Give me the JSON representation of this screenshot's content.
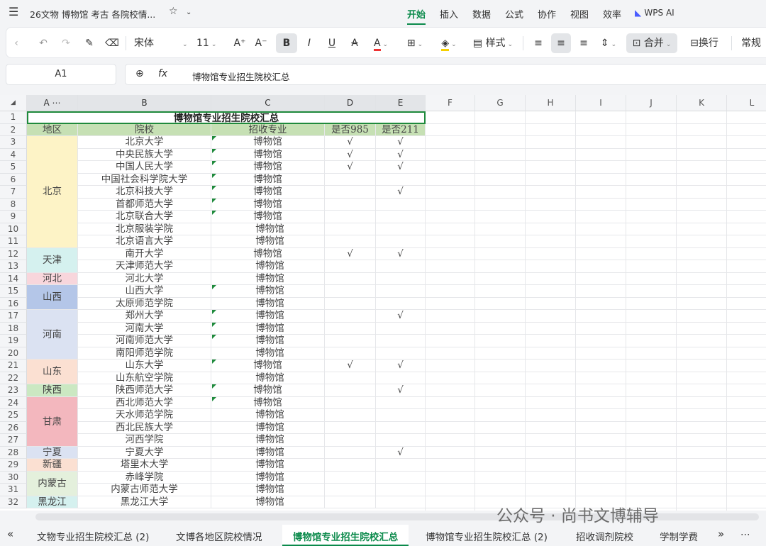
{
  "titlebar": {
    "menu_icon": "hamburger-icon",
    "doc_title": "26文物 博物馆 考古 各院校情...",
    "star_icon": "star-icon",
    "chevron_icon": "chevron-down-icon",
    "menus": [
      "开始",
      "插入",
      "数据",
      "公式",
      "协作",
      "视图",
      "效率"
    ],
    "active_menu": "开始",
    "ai_label": "WPS AI"
  },
  "toolbar": {
    "font_name": "宋体",
    "font_size": "11",
    "style_label": "样式",
    "merge_label": "合并",
    "wrap_label": "换行",
    "format_label": "常规"
  },
  "formula_bar": {
    "cell_ref": "A1",
    "fx": "fx",
    "content": "博物馆专业招生院校汇总"
  },
  "columns": [
    "A",
    "B",
    "C",
    "D",
    "E",
    "F",
    "G",
    "H",
    "I",
    "J",
    "K",
    "L"
  ],
  "rows": [
    "1",
    "2",
    "3",
    "4",
    "5",
    "6",
    "7",
    "8",
    "9",
    "10",
    "11",
    "12",
    "13",
    "14",
    "15",
    "16",
    "17",
    "18",
    "19",
    "20",
    "21",
    "22",
    "23",
    "24",
    "25",
    "26",
    "27",
    "28",
    "29",
    "30",
    "31",
    "32"
  ],
  "sheet": {
    "title": "博物馆专业招生院校汇总",
    "headers": [
      "地区",
      "院校",
      "招收专业",
      "是否985",
      "是否211"
    ],
    "regions": [
      {
        "name": "北京",
        "color": "#fdf3c6"
      },
      {
        "name": "天津",
        "color": "#d5f1ef"
      },
      {
        "name": "河北",
        "color": "#f8d6dc"
      },
      {
        "name": "山西",
        "color": "#b4c6e8"
      },
      {
        "name": "河南",
        "color": "#dbe2f2"
      },
      {
        "name": "山东",
        "color": "#fbe0d2"
      },
      {
        "name": "陕西",
        "color": "#cbe8c2"
      },
      {
        "name": "甘肃",
        "color": "#f3b7be"
      },
      {
        "name": "宁夏",
        "color": "#dbe2f2"
      },
      {
        "name": "新疆",
        "color": "#fbe0d2"
      },
      {
        "name": "内蒙古",
        "color": "#e4f0dc"
      },
      {
        "name": "黑龙江",
        "color": "#d5f1ef"
      }
    ],
    "schools": [
      "北京大学",
      "中央民族大学",
      "中国人民大学",
      "中国社会科学院大学",
      "北京科技大学",
      "首都师范大学",
      "北京联合大学",
      "北京服装学院",
      "北京语言大学",
      "南开大学",
      "天津师范大学",
      "河北大学",
      "山西大学",
      "太原师范学院",
      "郑州大学",
      "河南大学",
      "河南师范大学",
      "南阳师范学院",
      "山东大学",
      "山东航空学院",
      "陕西师范大学",
      "西北师范大学",
      "天水师范学院",
      "西北民族大学",
      "河西学院",
      "宁夏大学",
      "塔里木大学",
      "赤峰学院",
      "内蒙古师范大学",
      "黑龙江大学"
    ],
    "major": "博物馆",
    "is985": [
      "√",
      "",
      "√",
      "",
      "√",
      "",
      "",
      "",
      "",
      "",
      "",
      "",
      "√",
      "",
      "",
      "",
      "",
      "",
      "",
      "",
      "",
      "",
      "",
      "",
      "",
      "",
      "",
      "",
      "",
      "",
      "",
      "",
      "√",
      "",
      "",
      "",
      "",
      "",
      "",
      "",
      "",
      "",
      "",
      "",
      "",
      "",
      "",
      "",
      "",
      "",
      "",
      "",
      "",
      "",
      "",
      "",
      "",
      "",
      "",
      "",
      "",
      "",
      "",
      "",
      "",
      ""
    ],
    "d985": [
      "√",
      "√",
      "√",
      "",
      "",
      "",
      "",
      "",
      "",
      "√",
      "",
      "",
      "",
      "",
      "",
      "",
      "",
      "",
      "√",
      "",
      "",
      "",
      "",
      "",
      "",
      "",
      "",
      "",
      "",
      ""
    ],
    "e211": [
      "√",
      "√",
      "√",
      "",
      "√",
      "",
      "",
      "",
      "",
      "√",
      "",
      "",
      "",
      "",
      "√",
      "",
      "",
      "",
      "√",
      "",
      "√",
      "",
      "",
      "",
      "",
      "√",
      "",
      "",
      "",
      ""
    ]
  },
  "sheet_tabs": [
    "文物专业招生院校汇总 (2)",
    "文博各地区院校情况",
    "博物馆专业招生院校汇总",
    "博物馆专业招生院校汇总 (2)",
    "招收调剂院校",
    "学制学费"
  ],
  "active_tab": "博物馆专业招生院校汇总",
  "watermark": "公众号 · 尚书文博辅导"
}
